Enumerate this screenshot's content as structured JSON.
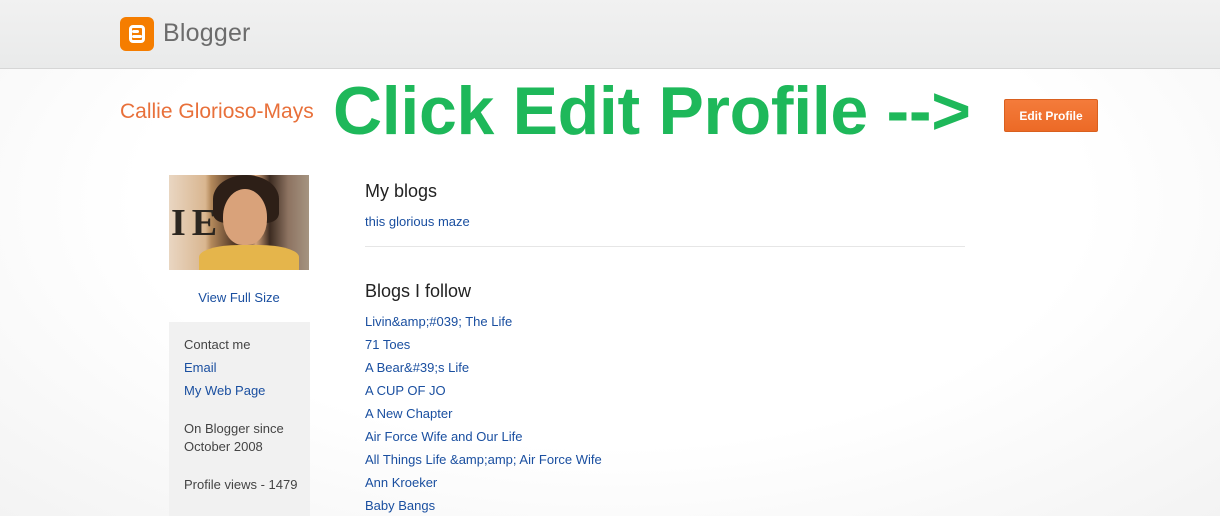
{
  "header": {
    "brand": "Blogger",
    "logo_icon": "blogger-logo-icon",
    "brand_color": "#f57d00"
  },
  "profile": {
    "name": "Callie Glorioso-Mays",
    "edit_button": "Edit Profile",
    "view_full_size": "View Full Size"
  },
  "overlay": {
    "annotation_text": "Click Edit Profile -->",
    "color": "#1eb85a"
  },
  "sidebar": {
    "contact_heading": "Contact me",
    "email_link": "Email",
    "web_page_link": "My Web Page",
    "since_line1": "On Blogger since",
    "since_line2": "October 2008",
    "profile_views": "Profile views - 1479"
  },
  "my_blogs": {
    "title": "My blogs",
    "items": [
      "this glorious maze"
    ]
  },
  "blogs_i_follow": {
    "title": "Blogs I follow",
    "items": [
      "Livin&amp;#039; The Life",
      "71 Toes",
      "A Bear&#39;s Life",
      "A CUP OF JO",
      "A New Chapter",
      "Air Force Wife and Our Life",
      "All Things Life &amp;amp; Air Force Wife",
      "Ann Kroeker",
      "Baby Bangs"
    ]
  }
}
